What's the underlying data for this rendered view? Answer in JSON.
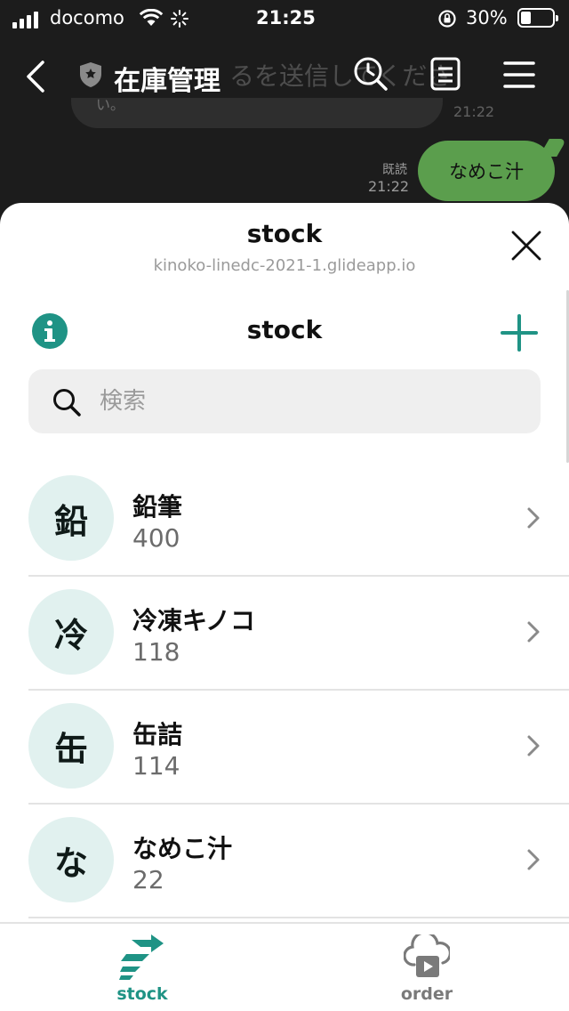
{
  "status_bar": {
    "carrier": "docomo",
    "time": "21:25",
    "battery": "30%"
  },
  "chat": {
    "title": "在庫管理",
    "ghost_text": "るを送信してくださ",
    "ghost_small": "い。",
    "ghost_time": "21:22",
    "read_label": "既読",
    "message_time": "21:22",
    "message": "なめこ汁"
  },
  "sheet": {
    "title": "stock",
    "url": "kinoko-linedc-2021-1.glideapp.io"
  },
  "app": {
    "title": "stock",
    "search_placeholder": "検索",
    "search_value": "",
    "accent_color": "#1f9385",
    "items": [
      {
        "avatar": "鉛",
        "name": "鉛筆",
        "count": "400"
      },
      {
        "avatar": "冷",
        "name": "冷凍キノコ",
        "count": "118"
      },
      {
        "avatar": "缶",
        "name": "缶詰",
        "count": "114"
      },
      {
        "avatar": "な",
        "name": "なめこ汁",
        "count": "22"
      }
    ],
    "tabs": [
      {
        "label": "stock",
        "icon": "stock-arrows-icon",
        "active": true
      },
      {
        "label": "order",
        "icon": "cloud-video-icon",
        "active": false
      }
    ]
  }
}
